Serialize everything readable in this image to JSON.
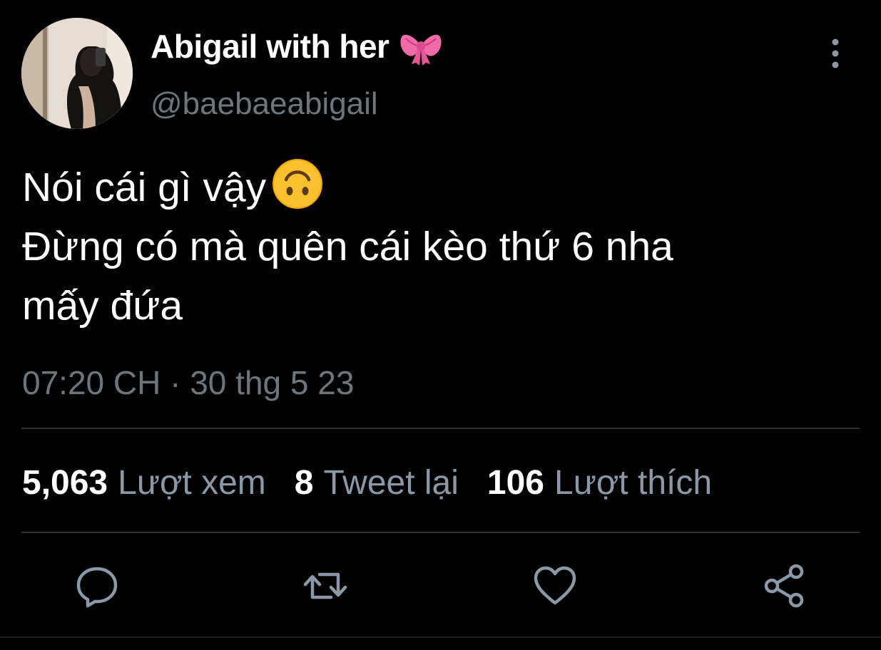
{
  "author": {
    "display_name": "Abigail with her",
    "handle": "@baebaeabigail",
    "name_emoji": "ribbon-bow-icon"
  },
  "tweet": {
    "lines": [
      "Nói cái gì vậy",
      "Đừng có mà quên cái kèo thứ 6 nha",
      "mấy đứa"
    ],
    "emoji": "upside-down-face-icon",
    "timestamp": "07:20 CH · 30 thg 5 23"
  },
  "stats": {
    "views_count": "5,063",
    "views_label": "Lượt xem",
    "retweets_count": "8",
    "retweets_label": "Tweet lại",
    "likes_count": "106",
    "likes_label": "Lượt thích"
  },
  "actions": {
    "reply": "reply-icon",
    "retweet": "retweet-icon",
    "like": "heart-icon",
    "share": "share-icon"
  },
  "colors": {
    "background": "#000000",
    "text": "#ffffff",
    "secondary": "#6e767d",
    "divider": "#2f3336",
    "icon": "#8b98a5"
  }
}
